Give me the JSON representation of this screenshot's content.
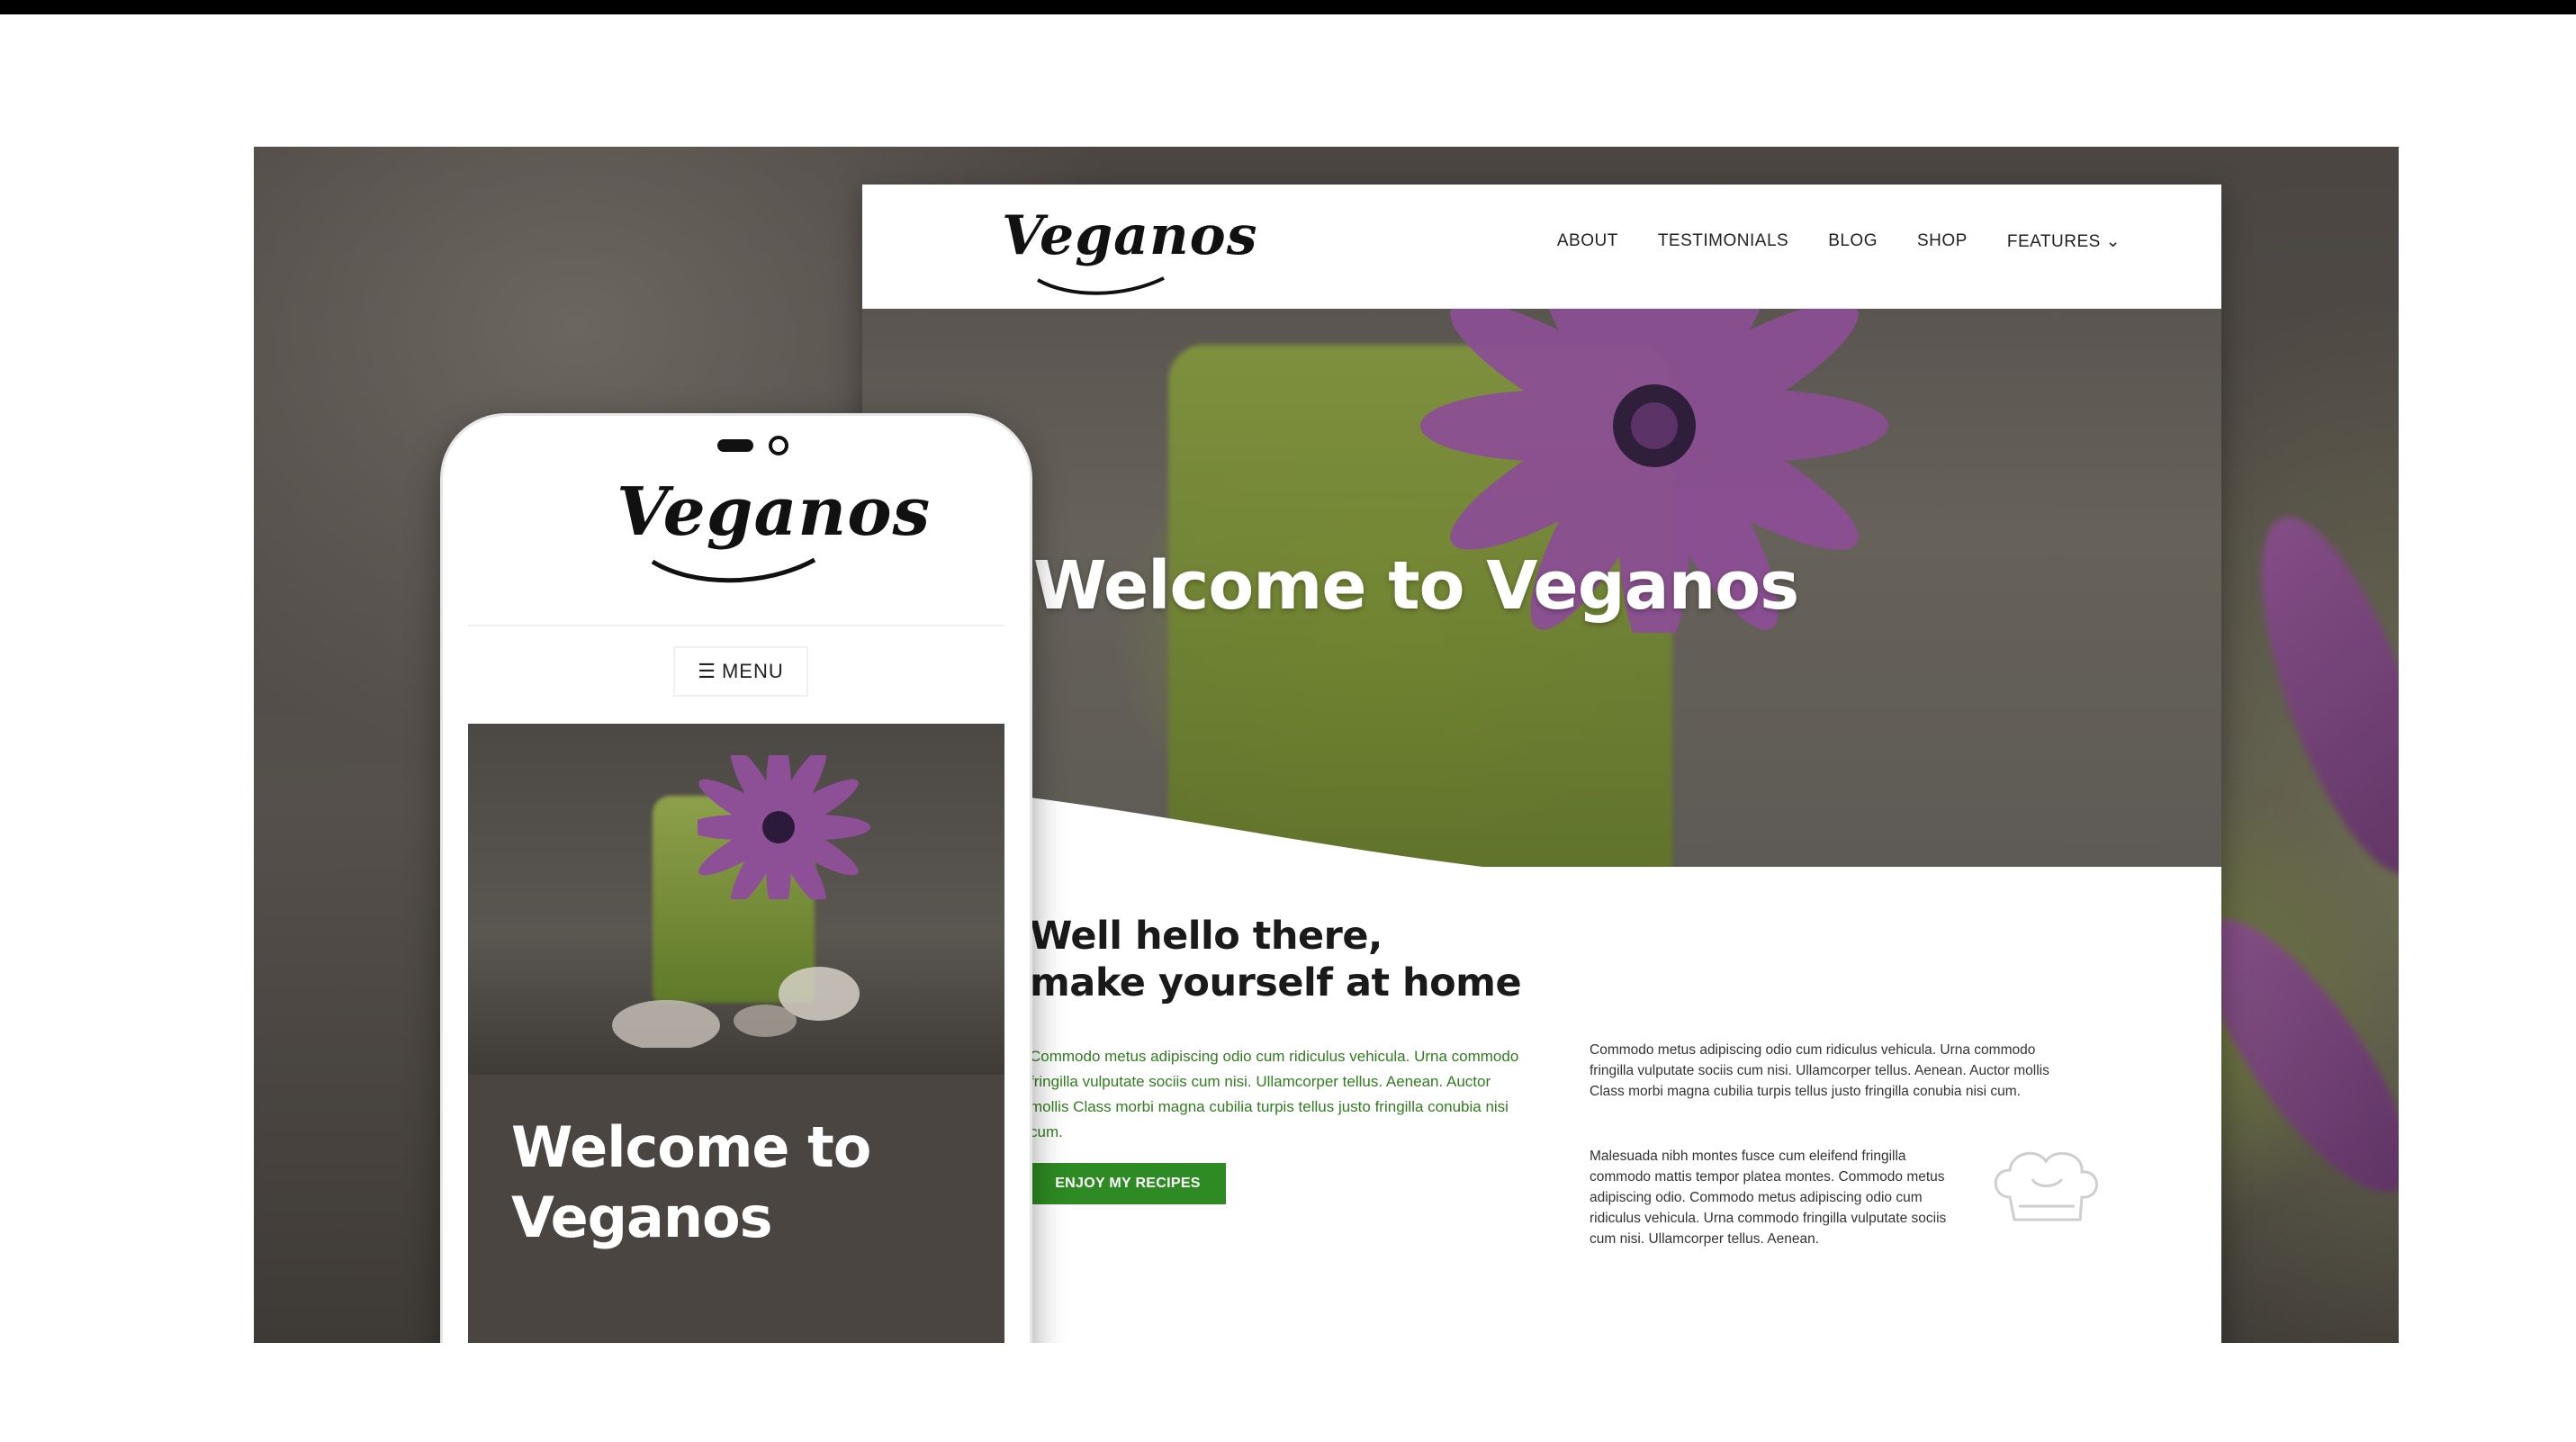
{
  "desktop": {
    "logo": "Veganos",
    "nav": {
      "about": "ABOUT",
      "testimonials": "TESTIMONIALS",
      "blog": "BLOG",
      "shop": "SHOP",
      "features": "FEATURES"
    },
    "hero_title": "Welcome to Veganos",
    "heading_line1": "Well hello there,",
    "heading_line2": "make yourself at home",
    "lead_text": "Commodo metus adipiscing odio cum ridiculus vehicula. Urna commodo fringilla vulputate sociis cum nisi. Ullamcorper tellus. Aenean. Auctor mollis Class morbi magna cubilia turpis tellus justo fringilla conubia nisi cum.",
    "cta_label": "ENJOY MY RECIPES",
    "paragraph1": "Commodo metus adipiscing odio cum ridiculus vehicula. Urna commodo fringilla vulputate sociis cum nisi. Ullamcorper tellus. Aenean. Auctor mollis Class morbi magna cubilia turpis tellus justo fringilla conubia nisi cum.",
    "paragraph2": "Malesuada nibh montes fusce cum eleifend fringilla commodo mattis tempor platea montes. Commodo metus adipiscing odio. Commodo metus adipiscing odio cum ridiculus vehicula. Urna commodo fringilla vulputate sociis cum nisi. Ullamcorper tellus. Aenean."
  },
  "mobile": {
    "logo": "Veganos",
    "menu_label": "MENU",
    "hero_title_line1": "Welcome to",
    "hero_title_line2": "Veganos"
  },
  "icons": {
    "menu": "hamburger-icon",
    "dropdown": "chevron-down-icon",
    "chef_hat": "chef-hat-icon"
  },
  "colors": {
    "accent_green": "#2e8a22",
    "lead_text_green": "#2f7d1d",
    "flower_purple": "#8a4e8f"
  }
}
